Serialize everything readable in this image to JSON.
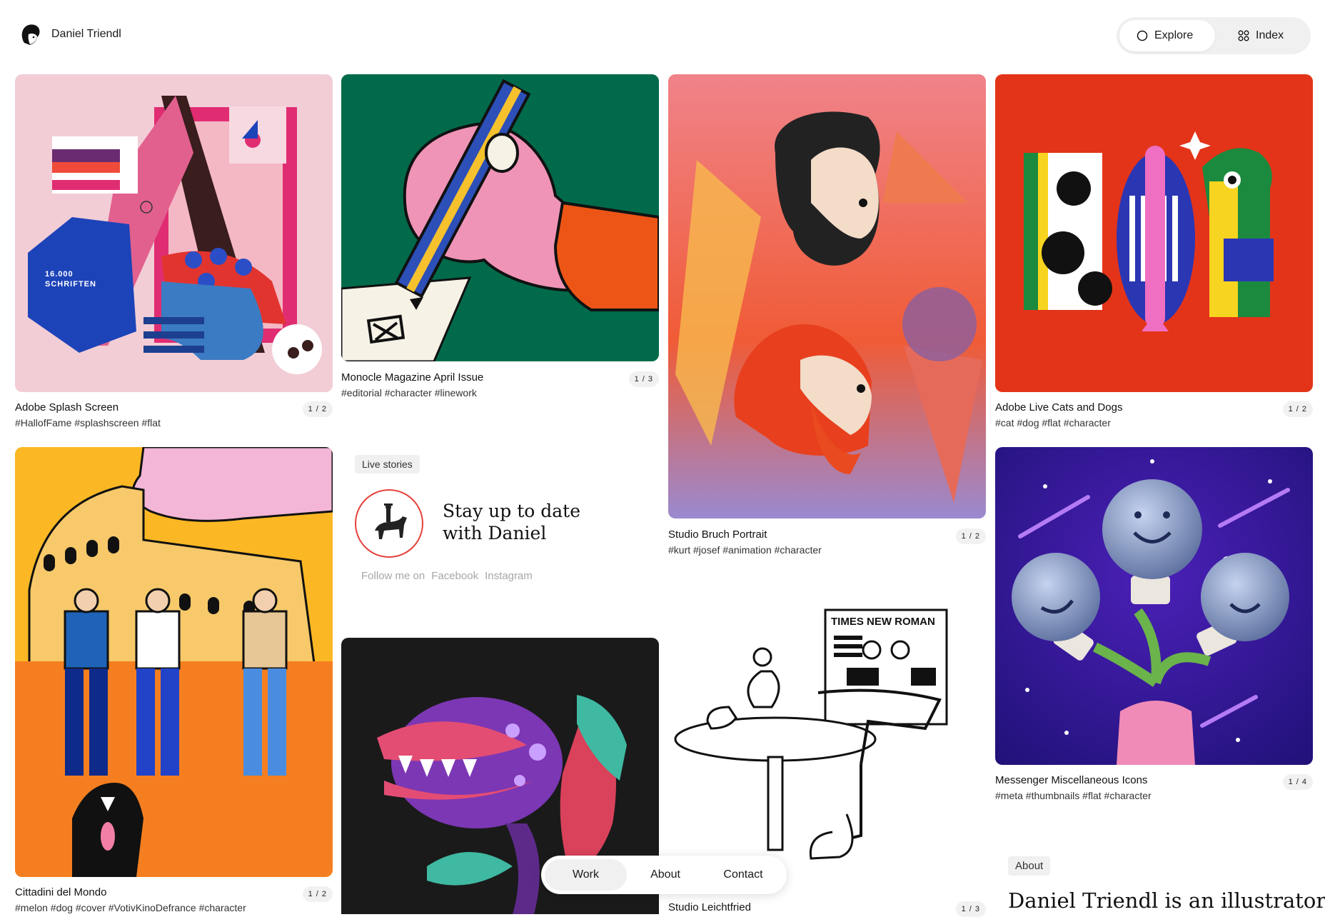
{
  "header": {
    "name": "Daniel Triendl",
    "toggle": {
      "explore": "Explore",
      "index": "Index"
    }
  },
  "cards": [
    {
      "title": "Adobe Splash Screen",
      "tags": "#HallofFame  #splashscreen  #flat",
      "count": "1 / 2"
    },
    {
      "title": "Monocle Magazine April Issue",
      "tags": "#editorial  #character  #linework",
      "count": "1 / 3"
    },
    {
      "title": "Studio Bruch Portrait",
      "tags": "#kurt  #josef  #animation  #character",
      "count": "1 / 2"
    },
    {
      "title": "Adobe Live Cats and Dogs",
      "tags": "#cat  #dog  #flat  #character",
      "count": "1 / 2"
    },
    {
      "title": "Cittadini del Mondo",
      "tags": "#melon  #dog  #cover  #VotivKinoDefrance  #character",
      "count": "1 / 2"
    },
    {
      "title": "Messenger Miscellaneous Icons",
      "tags": "#meta  #thumbnails  #flat  #character",
      "count": "1 / 4"
    },
    {
      "title": "Studio Leichtfried",
      "tags": "",
      "count": "1 / 3"
    }
  ],
  "illustration_text": {
    "schriften_line1": "16.000",
    "schriften_line2": "SCHRIFTEN",
    "newspaper": "TIMES NEW ROMAN"
  },
  "live": {
    "label": "Live stories",
    "heading_line1": "Stay up to date",
    "heading_line2": "with Daniel",
    "follow_label": "Follow me on",
    "links": [
      "Facebook",
      "Instagram"
    ]
  },
  "nav": [
    "Work",
    "About",
    "Contact"
  ],
  "about": {
    "label": "About",
    "text": "Daniel Triendl is an illustrator"
  }
}
